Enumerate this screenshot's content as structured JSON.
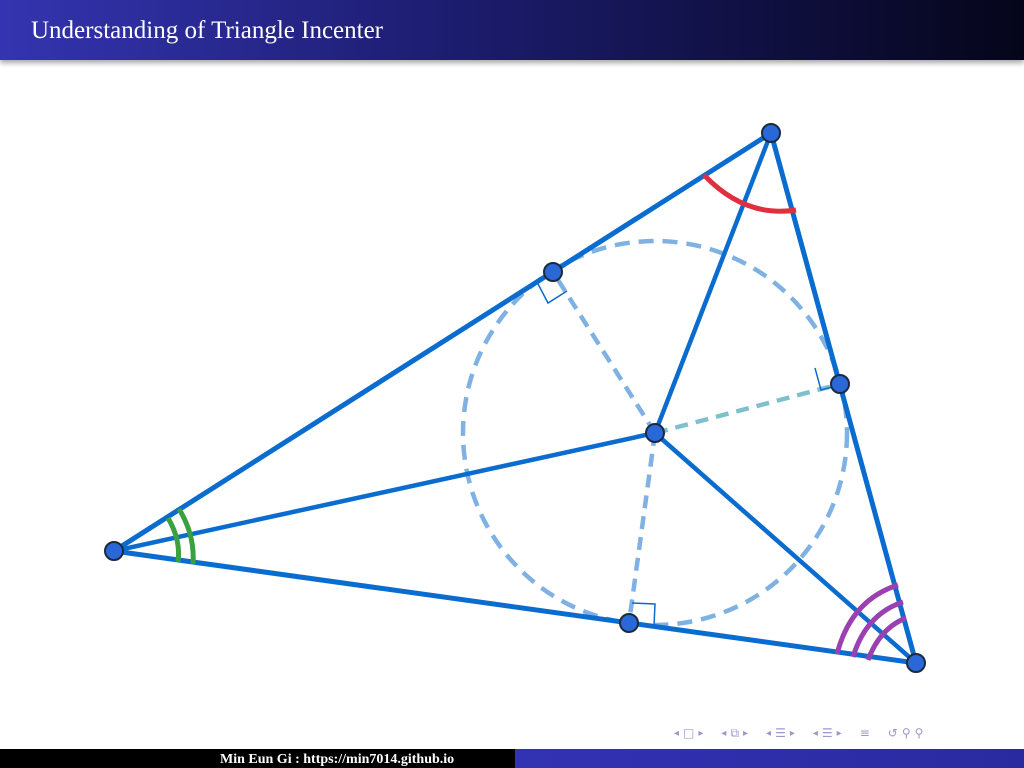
{
  "header": {
    "title": "Understanding of Triangle Incenter"
  },
  "footer": {
    "author_line": "Min Eun Gi : https://min7014.github.io"
  },
  "navigation": {
    "icons": [
      "prev-frame",
      "frame",
      "next-frame",
      "prev-subsection",
      "subsection",
      "next-subsection",
      "prev-section",
      "section",
      "next-section",
      "prev-slide",
      "slide",
      "next-slide",
      "appendix",
      "back",
      "search"
    ]
  },
  "colors": {
    "triangle": "#0a6ccf",
    "incircle": "#7fb1e3",
    "radius": "#7fb1e3",
    "radius_highlight": "#7fc0cf",
    "point_fill": "#2a68d8",
    "angle_top": "#e03040",
    "angle_left": "#3aa040",
    "angle_right": "#9a40b0",
    "title_bar_start": "#3434b0",
    "title_bar_end": "#05051a"
  }
}
